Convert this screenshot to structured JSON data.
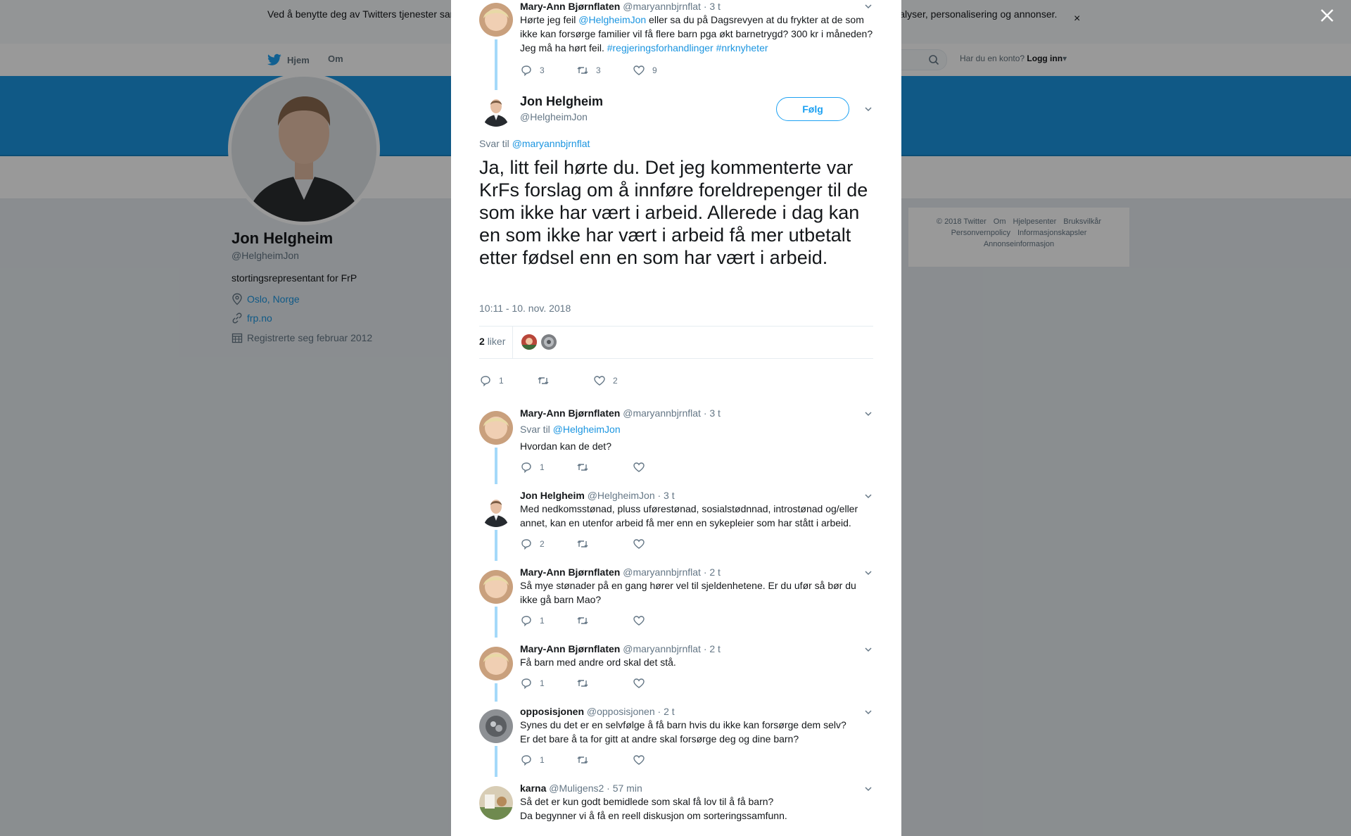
{
  "cookie": {
    "text": "Ved å benytte deg av Twitters tjenester samtykker du i vår bruk av informasjonskapsler. Vi og våre partnere bruker informasjonskapsler til bl.a. analyser, personalisering og annonser.",
    "close": "×"
  },
  "nav": {
    "home": "Hjem",
    "about": "Om",
    "login_prompt": "Har du en konto?",
    "login": "Logg inn"
  },
  "profile": {
    "name": "Jon Helgheim",
    "handle": "@HelgheimJon",
    "bio": "stortingsrepresentant for FrP",
    "location": "Oslo, Norge",
    "website": "frp.no",
    "joined": "Registrerte seg februar 2012"
  },
  "footer": {
    "row1": [
      "© 2018 Twitter",
      "Om",
      "Hjelpesenter",
      "Bruksvilkår"
    ],
    "row2": [
      "Personvernpolicy",
      "Informasjonskapsler"
    ],
    "row3": [
      "Annonseinformasjon"
    ]
  },
  "top_tweet": {
    "name": "Mary-Ann Bjørnflaten",
    "handle": "@maryannbjrnflat",
    "time": "· 3 t",
    "text_a": "Hørte jeg feil ",
    "mention": "@HelgheimJon",
    "text_b": " eller sa du på Dagsrevyen at du frykter at de som ikke kan forsørge familier vil få flere barn pga økt barnetrygd? 300 kr i måneden? Jeg må ha hørt feil. ",
    "hashtags": "#regjeringsforhandlinger #nrknyheter",
    "replies": "3",
    "retweets": "3",
    "likes": "9"
  },
  "main_tweet": {
    "name": "Jon Helgheim",
    "handle": "@HelgheimJon",
    "follow": "Følg",
    "reply_prefix": "Svar til",
    "reply_to": "@maryannbjrnflat",
    "text": "Ja, litt feil hørte du. Det jeg kommenterte var KrFs forslag om å innføre foreldrepenger til de som ikke har vært i arbeid. Allerede i dag kan en som ikke har vært i arbeid få mer utbetalt etter fødsel enn en som har vært i arbeid.",
    "timestamp": "10:11 - 10. nov. 2018",
    "like_count": "2",
    "like_label": "liker",
    "replies": "1",
    "likes": "2"
  },
  "replies": [
    {
      "name": "Mary-Ann Bjørnflaten",
      "handle": "@maryannbjrnflat",
      "time": "· 3 t",
      "reply_prefix": "Svar til",
      "reply_to": "@HelgheimJon",
      "line1": "Hvordan kan de det?",
      "line2": "",
      "replies": "1"
    },
    {
      "name": "Jon Helgheim",
      "handle": "@HelgheimJon",
      "time": "· 3 t",
      "line1": "Med nedkomsstønad, pluss uførestønad, sosialstødnnad, introstønad og/eller",
      "line2": "annet, kan en utenfor arbeid få mer enn en sykepleier som har stått i arbeid.",
      "replies": "2"
    },
    {
      "name": "Mary-Ann Bjørnflaten",
      "handle": "@maryannbjrnflat",
      "time": "· 2 t",
      "line1": "Så mye stønader på en gang hører vel til sjeldenhetene. Er du ufør så bør du",
      "line2": "ikke gå barn Mao?",
      "replies": "1"
    },
    {
      "name": "Mary-Ann Bjørnflaten",
      "handle": "@maryannbjrnflat",
      "time": "· 2 t",
      "line1": "Få barn med andre ord skal det stå.",
      "line2": "",
      "replies": "1"
    },
    {
      "name": "opposisjonen",
      "handle": "@opposisjonen",
      "time": "· 2 t",
      "line1": "Synes du det er en selvfølge å få barn hvis du ikke kan forsørge dem selv?",
      "line2": "Er det bare å ta for gitt at andre skal forsørge deg og dine barn?",
      "replies": "1"
    },
    {
      "name": "karna",
      "handle": "@Muligens2",
      "time": "· 57 min",
      "line1": "Så det er kun godt bemidlede som skal få lov til å få barn?",
      "line2": "Da begynner vi å få en reell diskusjon om sorteringssamfunn.",
      "replies": ""
    }
  ],
  "colors": {
    "accent": "#1da1f2",
    "banner": "#1b95e0",
    "link": "#1b95e0",
    "thread": "#a4d9f9"
  },
  "icons": [
    "twitter-bird-icon",
    "search-icon",
    "location-icon",
    "link-icon",
    "calendar-icon",
    "reply-icon",
    "retweet-icon",
    "heart-icon",
    "chevron-down-icon",
    "close-icon"
  ]
}
